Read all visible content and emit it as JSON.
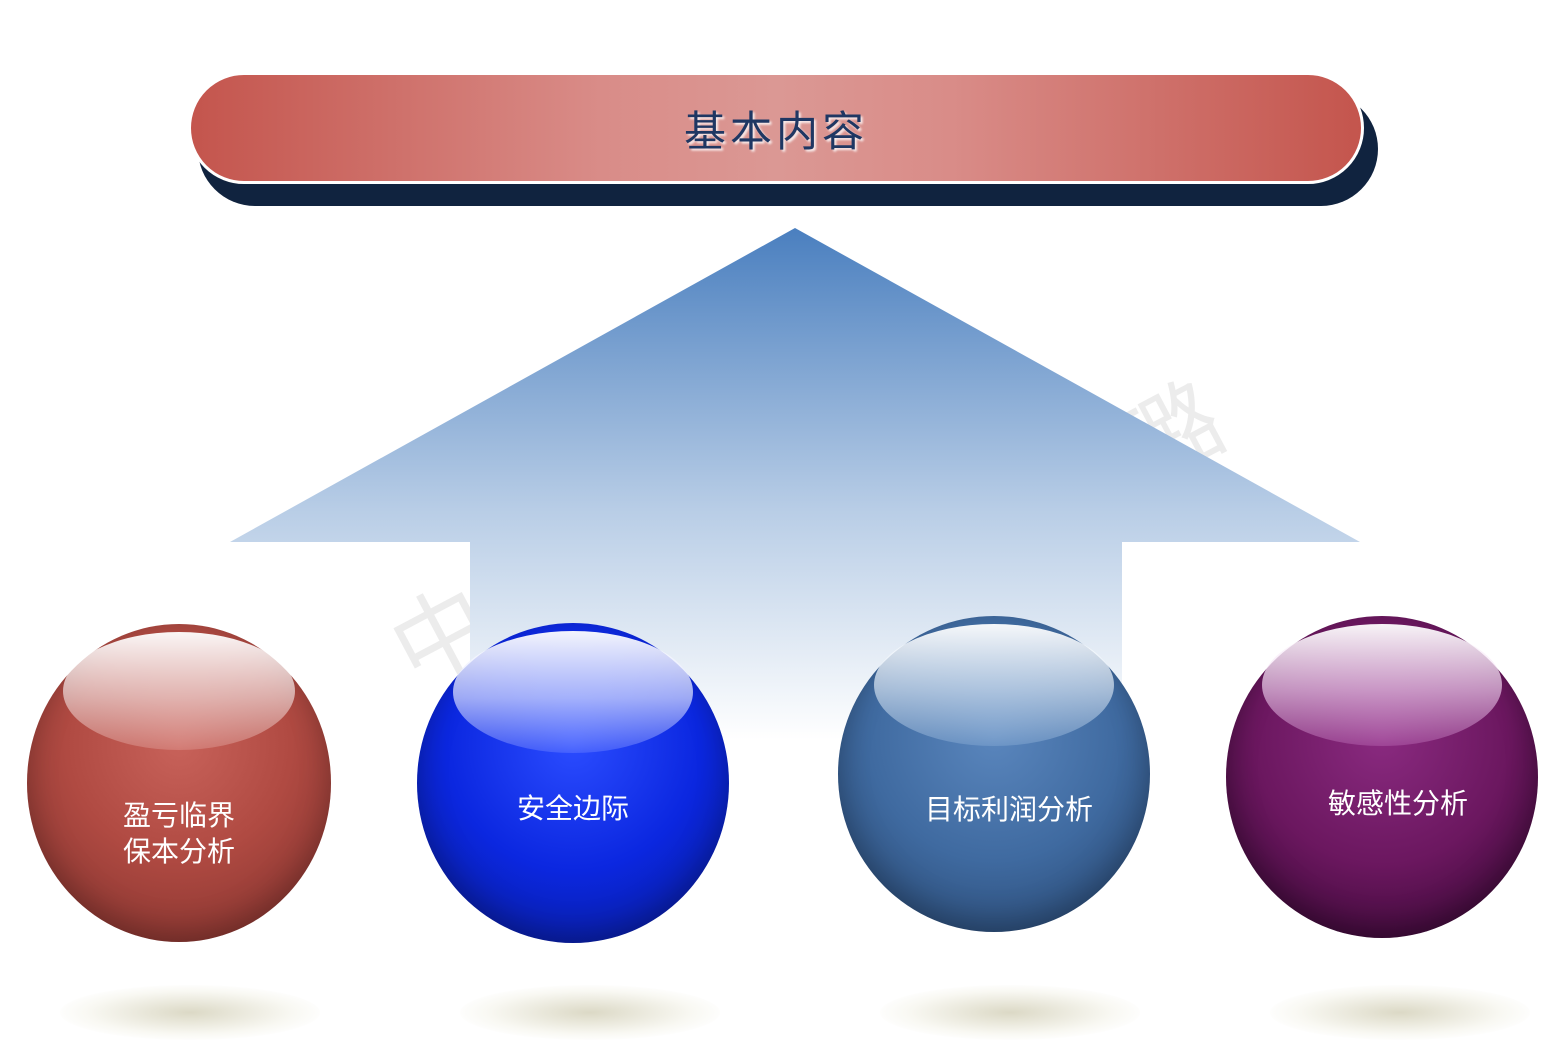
{
  "header": {
    "title": "基本内容"
  },
  "watermark": {
    "line_a": "中",
    "line_b": "珑璐"
  },
  "spheres": [
    {
      "label_line1": "盈亏临界",
      "label_line2": "保本分析",
      "color": "#b04a42"
    },
    {
      "label_line1": "安全边际",
      "label_line2": "",
      "color": "#0b27e0"
    },
    {
      "label_line1": "目标利润分析",
      "label_line2": "",
      "color": "#3f6aa0"
    },
    {
      "label_line1": "敏感性分析",
      "label_line2": "",
      "color": "#6b175f"
    }
  ],
  "colors": {
    "banner_edge": "#c4554d",
    "banner_center": "#db9894",
    "banner_shadow": "#10233f",
    "title_text": "#1f3763",
    "arrow_top": "#4a7fbf"
  }
}
